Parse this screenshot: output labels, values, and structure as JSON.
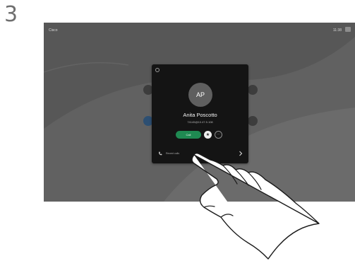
{
  "step_number": "3",
  "screen": {
    "brand": "Cisco",
    "clock": "11:38",
    "background_tiles": [
      {
        "label": ""
      },
      {
        "label": ""
      },
      {
        "label": ""
      },
      {
        "label": ""
      }
    ]
  },
  "contact_card": {
    "avatar_initials": "AP",
    "name": "Anita Poscotto",
    "address": "74145@10.47.5.108",
    "call_label": "Call",
    "recent_label": "Recent calls"
  },
  "colors": {
    "screen_bg": "#5e5e5e",
    "card_bg": "#141414",
    "call_green": "#1f8a52"
  },
  "icons": [
    "back-icon",
    "star-icon",
    "more-icon",
    "phone-icon",
    "chevron-right-icon"
  ]
}
